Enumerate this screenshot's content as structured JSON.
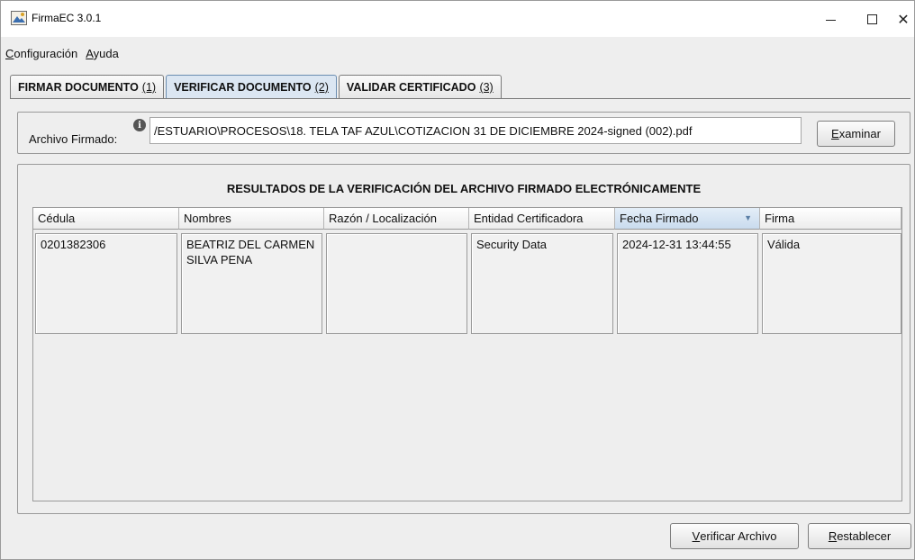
{
  "window": {
    "title": "FirmaEC 3.0.1",
    "controls": {
      "minimize": "—",
      "close": "✕"
    }
  },
  "menu": [
    {
      "mnemonic": "C",
      "rest": "onfiguración"
    },
    {
      "mnemonic": "A",
      "rest": "yuda"
    }
  ],
  "tabs": [
    {
      "label": "FIRMAR DOCUMENTO",
      "shortcut": "(1)",
      "active": false
    },
    {
      "label": "VERIFICAR DOCUMENTO",
      "shortcut": "(2)",
      "active": true
    },
    {
      "label": "VALIDAR CERTIFICADO",
      "shortcut": "(3)",
      "active": false
    }
  ],
  "file": {
    "label": "Archivo Firmado:",
    "info_icon": "i",
    "path": "/ESTUARIO\\PROCESOS\\18. TELA TAF AZUL\\COTIZACION 31 DE DICIEMBRE 2024-signed (002).pdf",
    "browse": {
      "mnemonic": "E",
      "rest": "xaminar"
    }
  },
  "results": {
    "title": "RESULTADOS DE LA VERIFICACIÓN DEL ARCHIVO FIRMADO ELECTRÓNICAMENTE",
    "columns": [
      "Cédula",
      "Nombres",
      "Razón / Localización",
      "Entidad Certificadora",
      "Fecha Firmado",
      "Firma"
    ],
    "sorted_column_arrow": "▼",
    "rows": [
      {
        "cedula": "0201382306",
        "nombres": "BEATRIZ DEL CARMEN SILVA PENA",
        "razon": "",
        "entidad": "Security Data",
        "fecha": "2024-12-31 13:44:55",
        "firma": "Válida"
      }
    ]
  },
  "actions": {
    "verify": {
      "mnemonic": "V",
      "rest": "erificar Archivo"
    },
    "reset": {
      "mnemonic": "R",
      "rest": "establecer"
    }
  },
  "colors": {
    "active_tab": "#dbe6f2",
    "sorted_header": "#c9dbee"
  }
}
